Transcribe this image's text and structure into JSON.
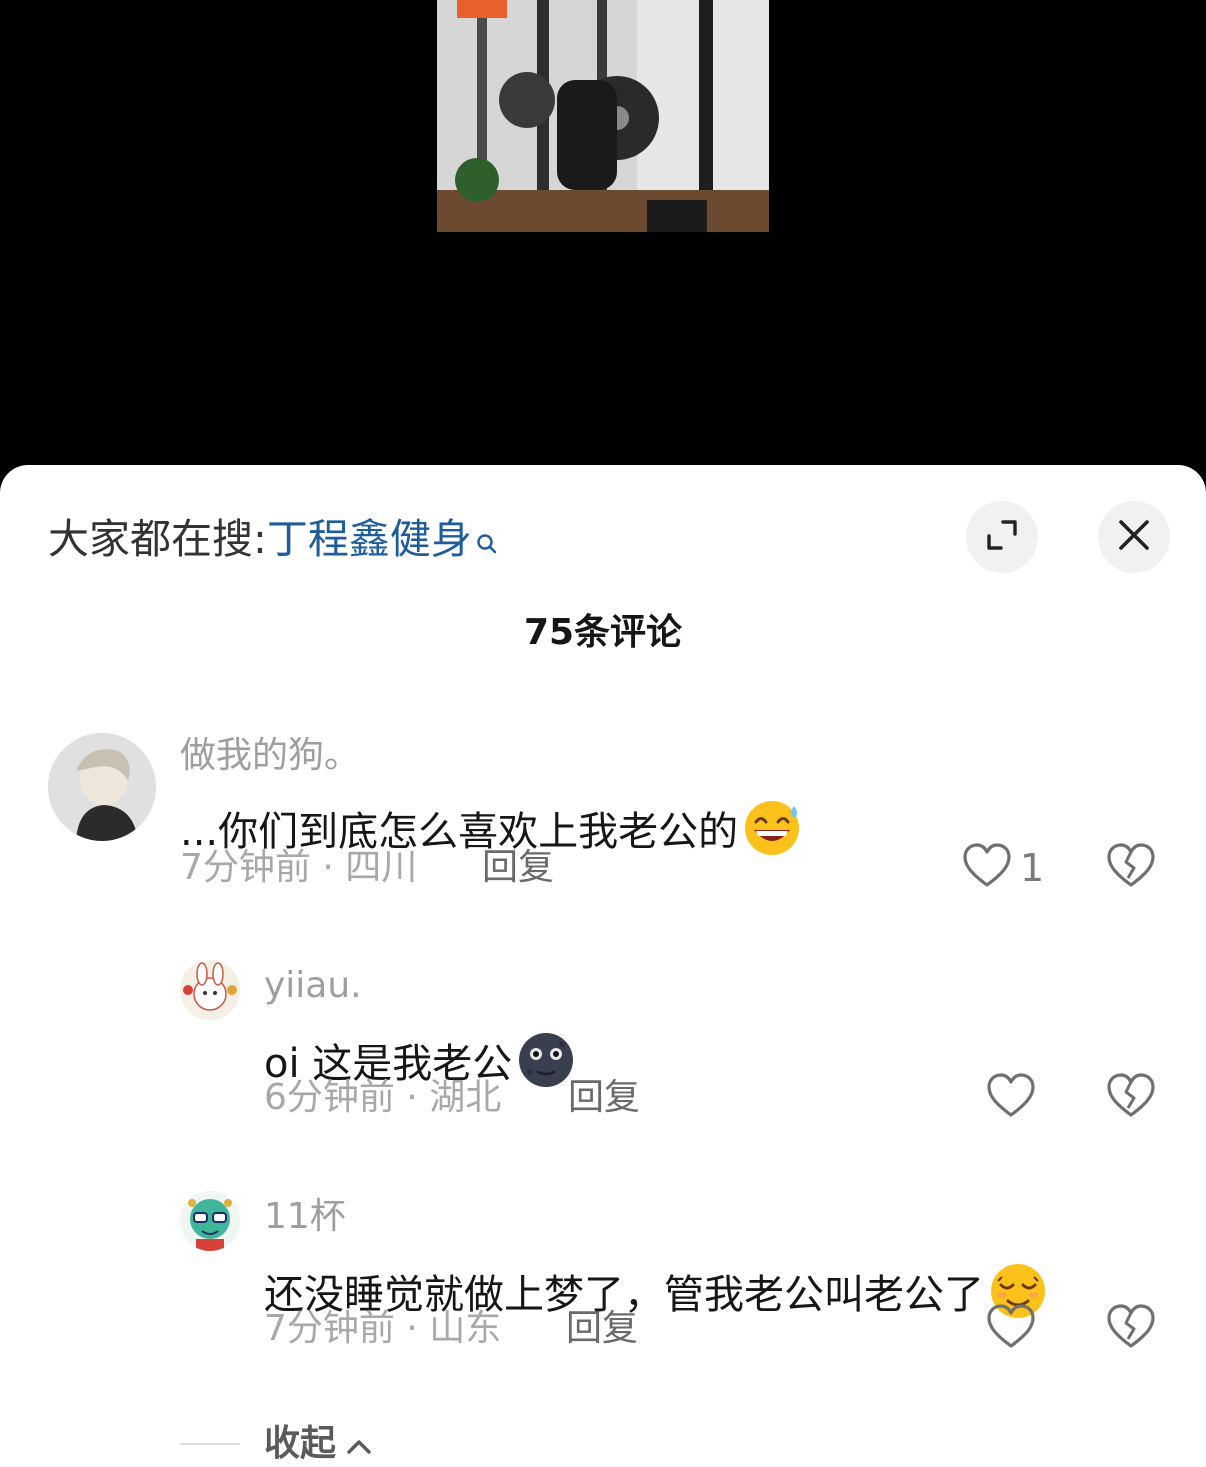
{
  "search": {
    "prefix": "大家都在搜:",
    "keyword": "丁程鑫健身"
  },
  "comment_count": "75条评论",
  "comments": [
    {
      "username": "做我的狗。",
      "text": "...你们到底怎么喜欢上我老公的",
      "emoji": "grinning-sweat-emoji",
      "time_location": "7分钟前 · 四川",
      "reply_label": "回复",
      "likes": "1"
    },
    {
      "username": "yiiau.",
      "text": "oi 这是我老公",
      "emoji": "new-moon-face-emoji",
      "time_location": "6分钟前 · 湖北",
      "reply_label": "回复",
      "likes": ""
    },
    {
      "username": "11杯",
      "text": "还没睡觉就做上梦了，管我老公叫老公了",
      "emoji": "relieved-smile-emoji",
      "time_location": "7分钟前 · 山东",
      "reply_label": "回复",
      "likes": ""
    }
  ],
  "collapse_label": "收起",
  "colors": {
    "keyword": "#1f5d9a",
    "meta": "#a8a8a8",
    "text": "#161616"
  }
}
